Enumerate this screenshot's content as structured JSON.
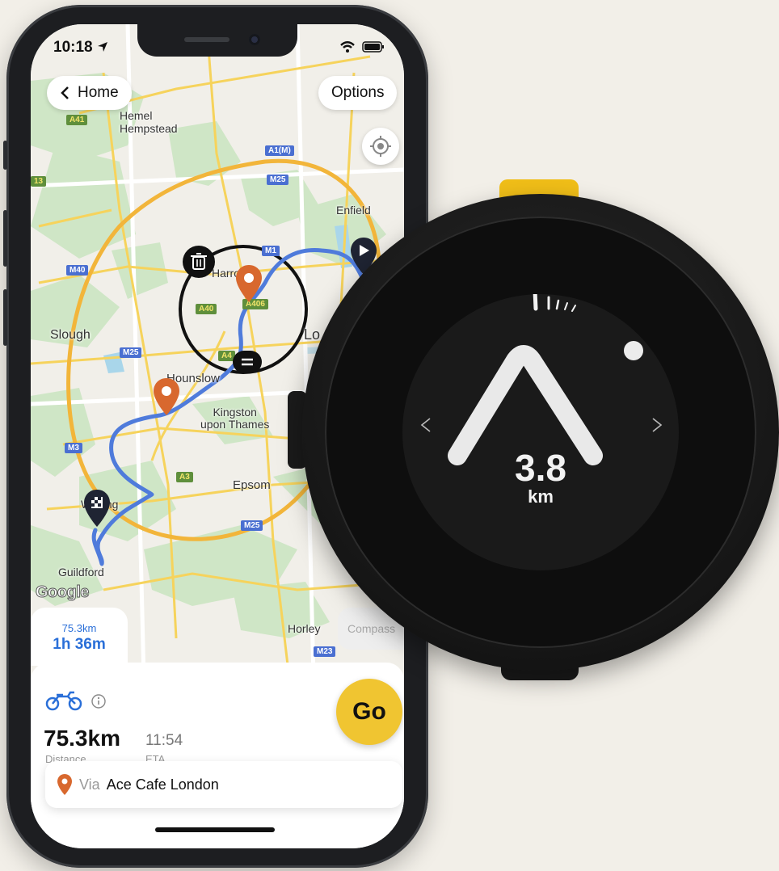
{
  "status_bar": {
    "time": "10:18"
  },
  "nav": {
    "back_label": "Home",
    "options_label": "Options"
  },
  "map": {
    "places": {
      "hemel": "Hemel\nHempstead",
      "enfield": "Enfield",
      "slough": "Slough",
      "hounslow": "Hounslow",
      "kingston": "Kingston\nupon Thames",
      "epsom": "Epsom",
      "guildford": "Guildford",
      "horley": "Horley",
      "woking": "Woking",
      "harrow": "Harrow",
      "london": "Lo"
    },
    "road_shields": [
      "A41",
      "A1(M)",
      "M25",
      "M1",
      "M40",
      "A40",
      "A406",
      "M25",
      "A4",
      "M3",
      "A3",
      "M25",
      "M23",
      "13"
    ],
    "attribution": "Google"
  },
  "route_summary_tab": {
    "distance": "75.3km",
    "duration": "1h 36m"
  },
  "compass_tab_label": "Compass",
  "route": {
    "vehicle_icon": "motorcycle-icon",
    "distance_value": "75.3km",
    "distance_label": "Distance",
    "eta_value": "11:54",
    "eta_label": "ETA"
  },
  "go_button_label": "Go",
  "waypoint": {
    "prefix": "Via",
    "name": "Ace Cafe London"
  },
  "device": {
    "distance_number": "3.8",
    "distance_unit": "km"
  },
  "colors": {
    "accent": "#f0c531",
    "route": "#4f7bdb",
    "pin_orange": "#d8682e",
    "tab_blue": "#2a6fd8"
  }
}
